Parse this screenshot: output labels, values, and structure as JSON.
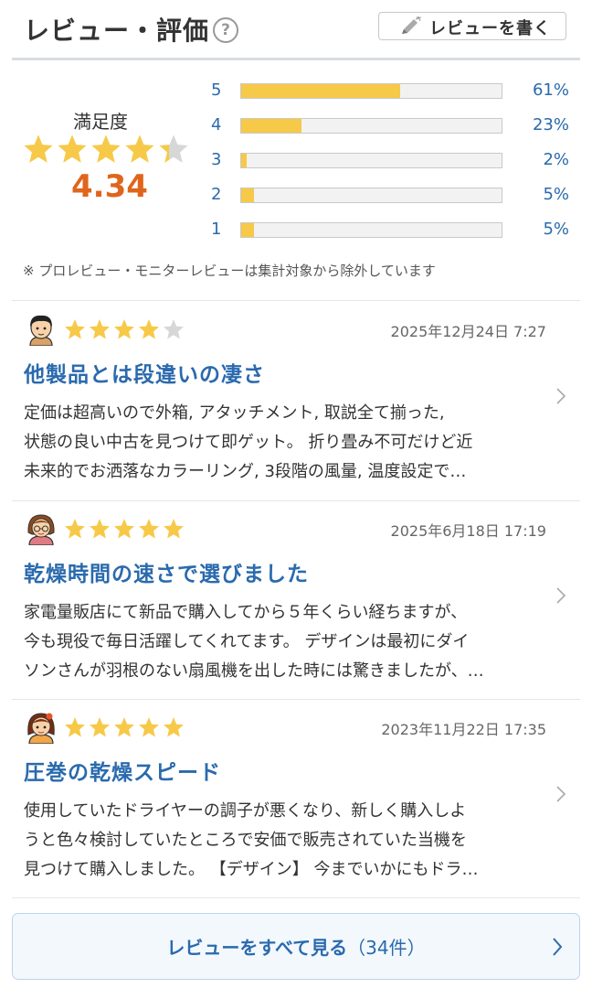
{
  "header": {
    "title": "レビュー・評価",
    "help_icon": "question-icon",
    "write_button": "レビューを書く",
    "write_icon": "pencil-icon"
  },
  "summary": {
    "label": "満足度",
    "average": "4.34",
    "average_value": 4.34,
    "star_max": 5,
    "star_color": "#f7c948",
    "distribution": [
      {
        "level": "5",
        "percent": "61%",
        "fraction": 0.61
      },
      {
        "level": "4",
        "percent": "23%",
        "fraction": 0.23
      },
      {
        "level": "3",
        "percent": "2%",
        "fraction": 0.02
      },
      {
        "level": "2",
        "percent": "5%",
        "fraction": 0.05
      },
      {
        "level": "1",
        "percent": "5%",
        "fraction": 0.05
      }
    ],
    "note": "※ プロレビュー・モニターレビューは集計対象から除外しています"
  },
  "reviews": [
    {
      "avatar": "man-avatar-icon",
      "rating": 4,
      "date": "2025年12月24日 7:27",
      "title": "他製品とは段違いの凄さ",
      "lines": [
        "定価は超高いので外箱, アタッチメント, 取説全て揃った,",
        "状態の良い中古を見つけて即ゲット。 折り畳み不可だけど近",
        "未来的でお洒落なカラーリング, 3段階の風量, 温度設定で…"
      ]
    },
    {
      "avatar": "woman-glasses-avatar-icon",
      "rating": 5,
      "date": "2025年6月18日 17:19",
      "title": "乾燥時間の速さで選びました",
      "lines": [
        "家電量販店にて新品で購入してから５年くらい経ちますが、",
        "今も現役で毎日活躍してくれてます。 デザインは最初にダイ",
        "ソンさんが羽根のない扇風機を出した時には驚きましたが、…"
      ]
    },
    {
      "avatar": "girl-avatar-icon",
      "rating": 5,
      "date": "2023年11月22日 17:35",
      "title": "圧巻の乾燥スピード",
      "lines": [
        "使用していたドライヤーの調子が悪くなり、新しく購入しよ",
        "うと色々検討していたところで安価で販売されていた当機を",
        "見つけて購入しました。 【デザイン】 今までいかにもドラ…"
      ]
    }
  ],
  "footer": {
    "all_reviews": "レビューをすべて見る",
    "count": "（34件）",
    "chevron_icon": "chevron-right-icon"
  },
  "colors": {
    "link": "#2a6aad",
    "accent": "#e0651c",
    "star": "#f7c948",
    "star_empty": "#d7d7d7"
  }
}
